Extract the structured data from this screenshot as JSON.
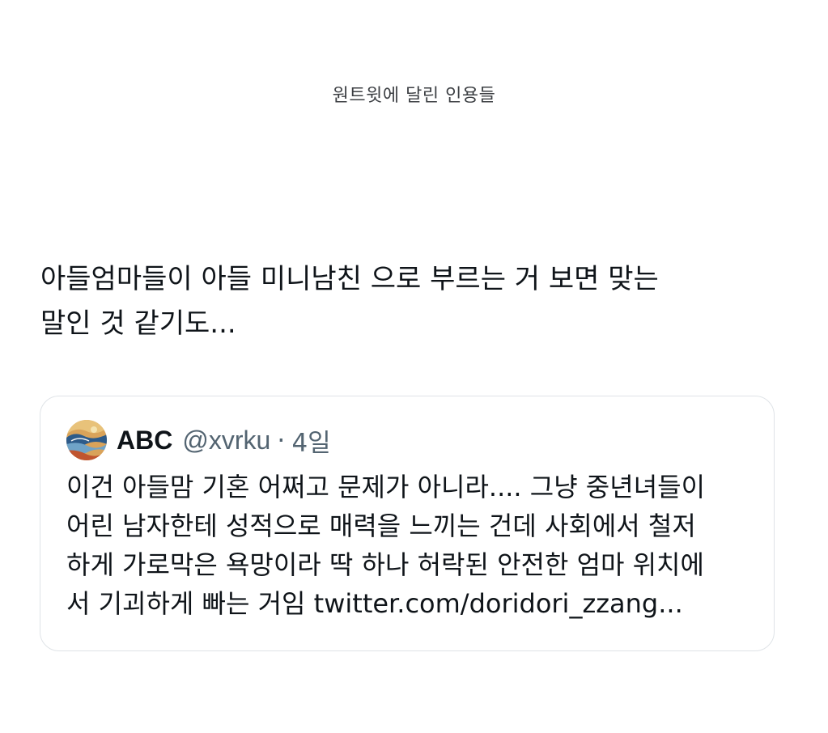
{
  "header": {
    "title": "원트윗에 달린 인용들"
  },
  "tweet": {
    "text": "아들엄마들이 아들 미니남친 으로 부르는 거 보면 맞는\n말인 것 같기도..."
  },
  "quote": {
    "author": {
      "display_name": "ABC",
      "handle": "@xvrku",
      "separator": "·",
      "time": "4일"
    },
    "avatar_icon": "avatar-painting-icon",
    "body_text": "이건 아들맘 기혼 어쩌고 문제가 아니라.... 그냥 중년녀들이\n어린 남자한테 성적으로 매력을 느끼는 건데 사회에서 철저\n하게 가로막은 욕망이라 딱 하나 허락된 안전한 엄마 위치에\n서 기괴하게 빠는 거임 ",
    "link_text": "twitter.com/doridori_zzang..."
  },
  "colors": {
    "text": "#0f1419",
    "secondary": "#536471",
    "border": "#dfe3e7"
  }
}
